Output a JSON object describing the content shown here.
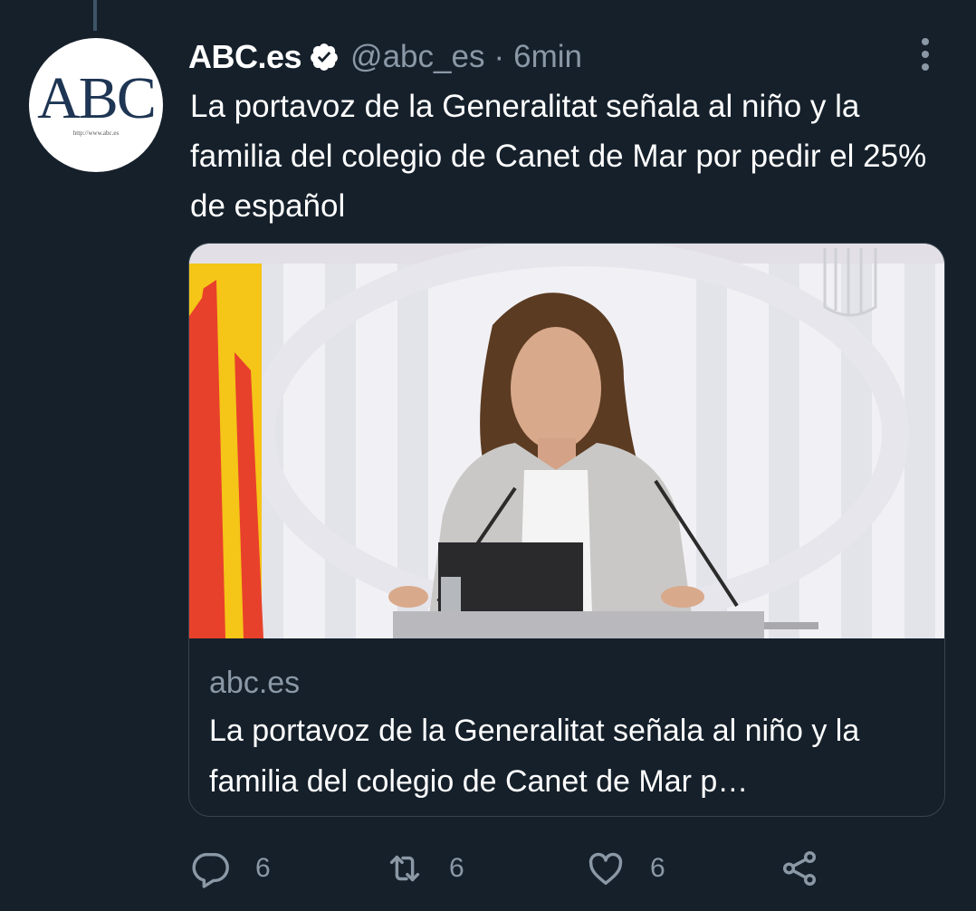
{
  "account": {
    "name": "ABC.es",
    "handle": "@abc_es",
    "separator": "·",
    "time": "6min",
    "avatar_logo": "ABC",
    "avatar_url": "http://www.abc.es",
    "verified_icon": "verified-badge-icon"
  },
  "tweet": {
    "text": "La portavoz de la Generalitat señala al niño y la familia del colegio de Canet de Mar por pedir el 25% de español"
  },
  "card": {
    "domain": "abc.es",
    "title": "La portavoz de la Generalitat señala al niño y la familia del colegio de Canet de Mar p…"
  },
  "actions": {
    "reply_count": "6",
    "retweet_count": "6",
    "like_count": "6",
    "icons": [
      "reply-icon",
      "retweet-icon",
      "like-icon",
      "share-icon"
    ]
  },
  "colors": {
    "background": "#15202b",
    "text": "#ffffff",
    "secondary": "#8b98a5",
    "border": "#38444d"
  }
}
